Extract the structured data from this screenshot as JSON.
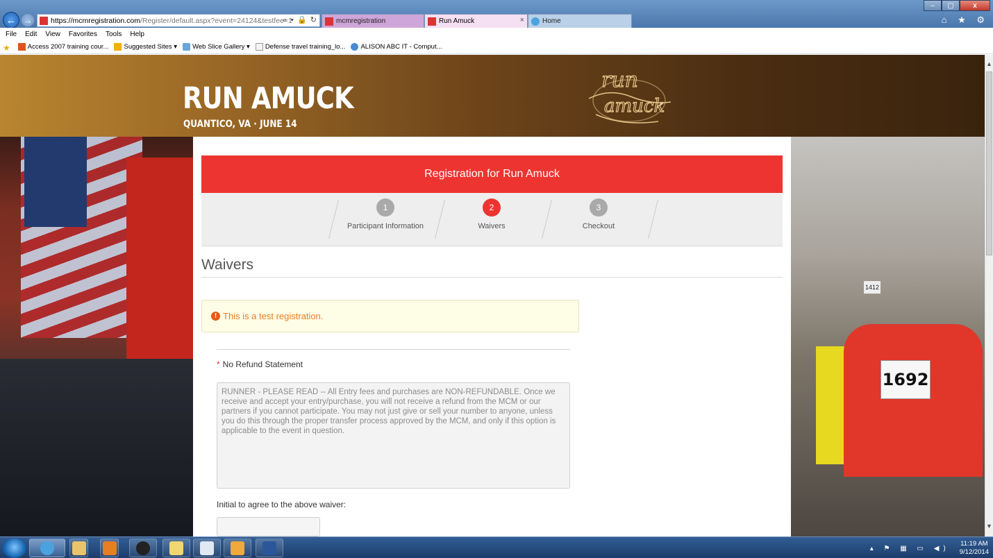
{
  "browser": {
    "address_host": "https://mcmregistration.com",
    "address_path": "/Register/default.aspx?event=24124&testfee=1",
    "address_controls": "⌕ ▾ 🔒 ↻",
    "tabs": [
      {
        "label": "mcmregistration"
      },
      {
        "label": "Run Amuck",
        "close": "×"
      },
      {
        "label": "Home"
      }
    ],
    "menu": [
      "File",
      "Edit",
      "View",
      "Favorites",
      "Tools",
      "Help"
    ],
    "favorites": [
      {
        "label": "Access 2007 training cour...",
        "icon": "office-icon"
      },
      {
        "label": "Suggested Sites ▾",
        "icon": "bing-icon"
      },
      {
        "label": "Web Slice Gallery ▾",
        "icon": "web-slice-icon"
      },
      {
        "label": "Defense travel training_lo...",
        "icon": "page-icon"
      },
      {
        "label": "ALISON ABC IT - Comput...",
        "icon": "globe-icon"
      }
    ],
    "window_buttons": {
      "minimize": "–",
      "maximize": "▢",
      "close": "x"
    },
    "toolbar_icons": "⌂ ★ ⚙"
  },
  "banner": {
    "title": "RUN AMUCK",
    "subtitle": "QUANTICO, VA · JUNE 14",
    "logo_text_top": "run",
    "logo_text_bottom": "amuck"
  },
  "photos": {
    "bib_number": "1692",
    "bib_small": "1412"
  },
  "registration": {
    "header": "Registration for Run Amuck",
    "steps": [
      {
        "number": "1",
        "label": "Participant Information",
        "active": false
      },
      {
        "number": "2",
        "label": "Waivers",
        "active": true
      },
      {
        "number": "3",
        "label": "Checkout",
        "active": false
      }
    ],
    "page_title": "Waivers",
    "alert_icon": "!",
    "alert": "This is a test registration.",
    "waiver_required_mark": "*",
    "waiver_label": "No Refund Statement",
    "waiver_text": "RUNNER - PLEASE READ  --  All Entry fees and purchases are NON-REFUNDABLE. Once we receive and accept your entry/purchase, you will not receive a refund from the MCM or our partners if you cannot participate. You may not just give or sell your number to anyone, unless you do this through the proper transfer process approved by the MCM, and only if this option is applicable to the event in question.",
    "initial_label": "Initial to agree to the above waiver:",
    "initial_value": ""
  },
  "taskbar": {
    "tray_icons": "▴ ⚑ ▦ ▭ ◀)",
    "time": "11:19 AM",
    "date": "9/12/2014"
  },
  "colors": {
    "accent_red": "#ee3430",
    "alert_text": "#ef7d26",
    "alert_bg": "#fefde6",
    "step_inactive": "#a9a9a9"
  }
}
